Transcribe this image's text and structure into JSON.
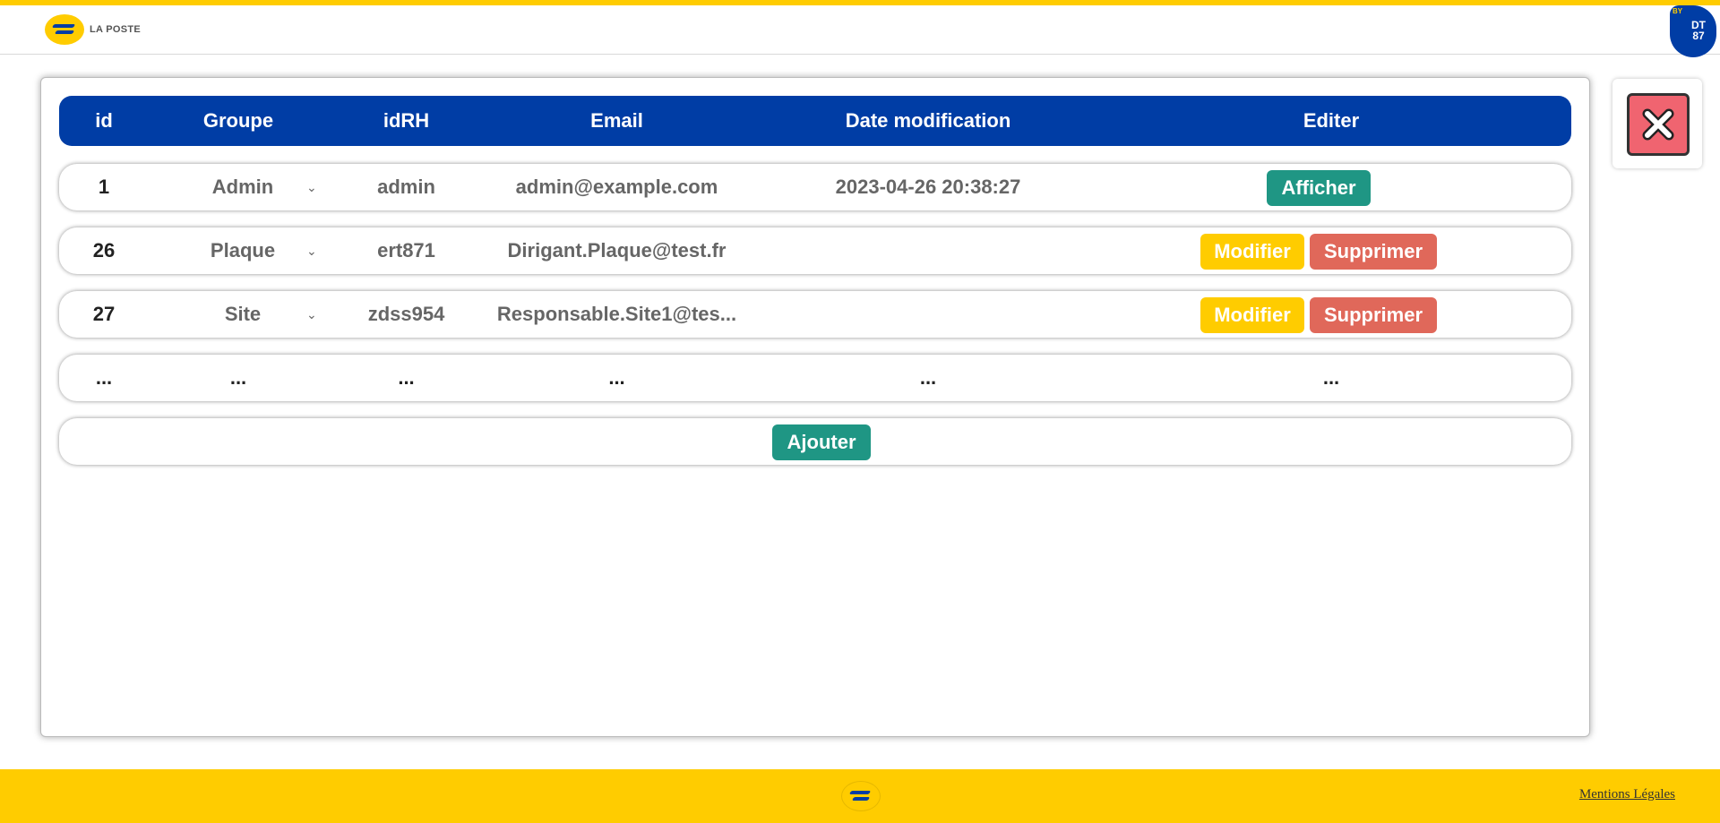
{
  "header": {
    "logo_text": "LA POSTE",
    "badge_by": "BY",
    "badge_line1": "DT",
    "badge_line2": "87"
  },
  "table": {
    "columns": [
      "id",
      "Groupe",
      "idRH",
      "Email",
      "Date modification",
      "Editer"
    ],
    "rows": [
      {
        "id": "1",
        "groupe": "Admin",
        "idrh": "admin",
        "email": "admin@example.com",
        "date": "2023-04-26 20:38:27",
        "action_primary": "Afficher"
      },
      {
        "id": "26",
        "groupe": "Plaque",
        "idrh": "ert871",
        "email": "Dirigant.Plaque@test.fr",
        "date": "",
        "action_modify": "Modifier",
        "action_delete": "Supprimer"
      },
      {
        "id": "27",
        "groupe": "Site",
        "idrh": "zdss954",
        "email": "Responsable.Site1@tes...",
        "date": "",
        "action_modify": "Modifier",
        "action_delete": "Supprimer"
      }
    ],
    "ellipsis": "...",
    "add_label": "Ajouter"
  },
  "footer": {
    "mentions": "Mentions Légales"
  },
  "colors": {
    "brand_yellow": "#ffcc00",
    "brand_blue": "#003da5",
    "teal": "#1f9684",
    "red": "#e0685a"
  },
  "icons": [
    "la-poste-logo-icon",
    "close-icon",
    "chevron-down-icon"
  ]
}
